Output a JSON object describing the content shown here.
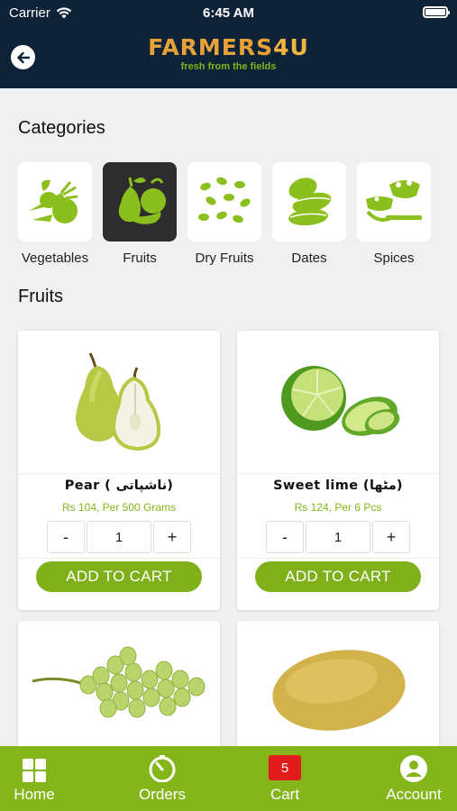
{
  "status_bar": {
    "carrier": "Carrier",
    "time": "6:45 AM"
  },
  "header": {
    "brand": "FARMERS",
    "brand_suffix": "4U",
    "tagline": "fresh from the fields"
  },
  "categories_title": "Categories",
  "categories": [
    {
      "label": "Vegetables",
      "icon": "vegetables-icon",
      "selected": false
    },
    {
      "label": "Fruits",
      "icon": "fruits-icon",
      "selected": true
    },
    {
      "label": "Dry Fruits",
      "icon": "dry-fruits-icon",
      "selected": false
    },
    {
      "label": "Dates",
      "icon": "dates-icon",
      "selected": false
    },
    {
      "label": "Spices",
      "icon": "spices-icon",
      "selected": false
    }
  ],
  "section_title": "Fruits",
  "products": [
    {
      "name": "Pear ( ناشپاتی)",
      "price": "Rs 104, Per 500 Grams",
      "qty": "1",
      "image": "pear-image"
    },
    {
      "name": "Sweet lime (مٹھا)",
      "price": "Rs 124, Per 6 Pcs",
      "qty": "1",
      "image": "sweet-lime-image"
    },
    {
      "image": "grapes-image"
    },
    {
      "image": "melon-image"
    }
  ],
  "controls": {
    "minus": "-",
    "plus": "+",
    "add_to_cart": "ADD TO CART"
  },
  "tabbar": {
    "home": "Home",
    "orders": "Orders",
    "cart": "Cart",
    "cart_count": "5",
    "account": "Account"
  },
  "colors": {
    "header_bg": "#0e2238",
    "accent_green": "#84b51a",
    "brand_orange": "#e8a038",
    "badge_red": "#e31b1b"
  }
}
